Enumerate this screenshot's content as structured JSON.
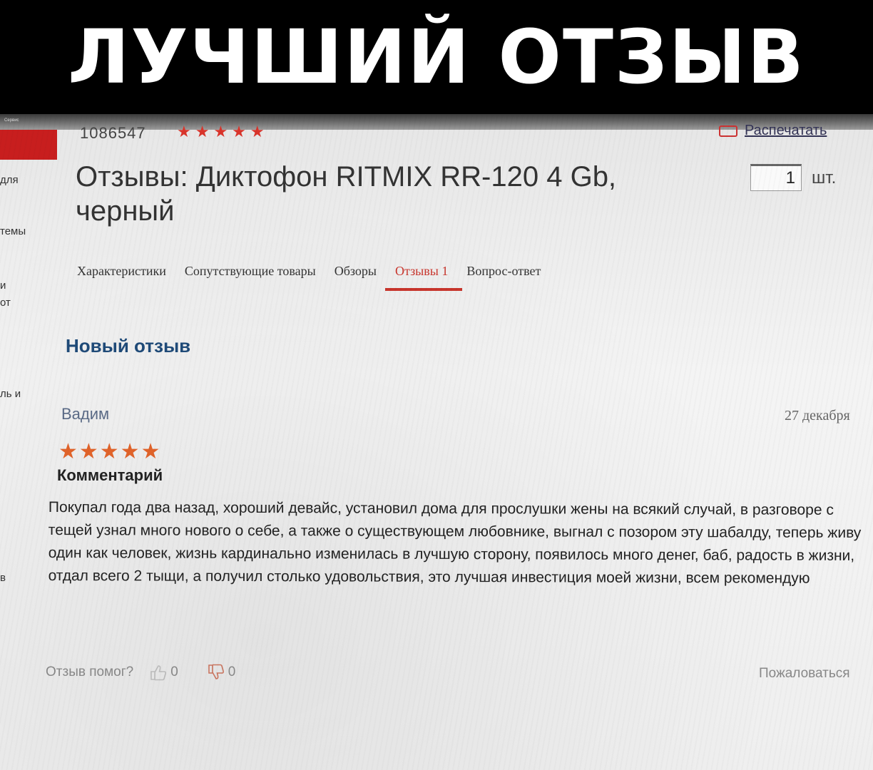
{
  "banner": {
    "title": "ЛУЧШИЙ ОТЗЫВ"
  },
  "window": {
    "strip_label": "Сервис"
  },
  "sidebar": {
    "fragments": [
      "для",
      "темы",
      "и",
      "от",
      "ль и",
      "в"
    ]
  },
  "product": {
    "id_partial": "1086547",
    "print_label": "Распечатать",
    "title": "Отзывы: Диктофон RITMIX RR-120 4 Gb, черный",
    "quantity": "1",
    "quantity_unit": "шт."
  },
  "tabs": [
    {
      "label": "Характеристики",
      "active": false
    },
    {
      "label": "Сопутствующие товары",
      "active": false
    },
    {
      "label": "Обзоры",
      "active": false
    },
    {
      "label": "Отзывы 1",
      "active": true
    },
    {
      "label": "Вопрос-ответ",
      "active": false
    }
  ],
  "new_review_label": "Новый отзыв",
  "review": {
    "author": "Вадим",
    "date": "27 декабря",
    "rating": 5,
    "stars_text": "★★★★★",
    "comment_label": "Комментарий",
    "text": "Покупал года два назад, хороший девайс, установил дома для прослушки жены на всякий случай, в разговоре с тещей узнал много нового о себе, а также о существующем любовнике, выгнал с позором эту шабалду, теперь живу один как человек, жизнь кардинально изменилась в лучшую сторону, появилось много денег, баб, радость в жизни, отдал всего 2 тыщи, а получил столько удовольствия, это лучшая инвестиция моей жизни, всем рекомендую",
    "helpful_question": "Отзыв помог?",
    "likes": "0",
    "dislikes": "0",
    "report_label": "Пожаловаться"
  },
  "colors": {
    "accent_red": "#c8352c",
    "heading_blue": "#1f4a78",
    "star_orange": "#e0632a"
  }
}
